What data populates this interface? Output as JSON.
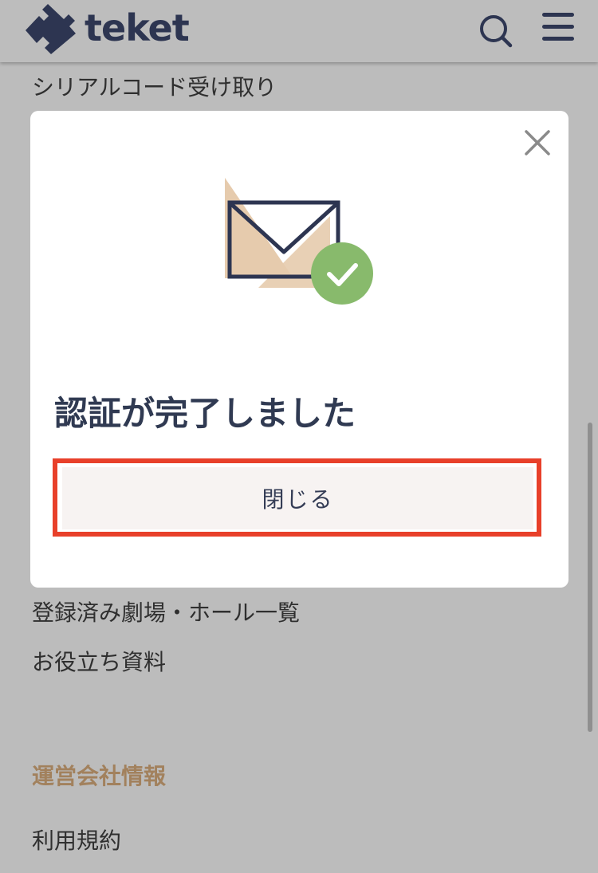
{
  "header": {
    "brand": "teket",
    "icons": [
      "teket-logo-icon",
      "search-icon",
      "hamburger-menu-icon"
    ],
    "brand_color": "#2d3551"
  },
  "menu": {
    "serial_code": "シリアルコード受け取り",
    "theaters": "登録済み劇場・ホール一覧",
    "resources": "お役立ち資料"
  },
  "company_section": {
    "title": "運営会社情報",
    "title_color": "#a2815d",
    "terms": "利用規約"
  },
  "modal": {
    "title": "認証が完了しました",
    "close_button_label": "閉じる",
    "icons": [
      "close-icon",
      "mail-verified-icon"
    ],
    "highlight_color": "#e8402a",
    "check_color": "#88ba6c"
  }
}
